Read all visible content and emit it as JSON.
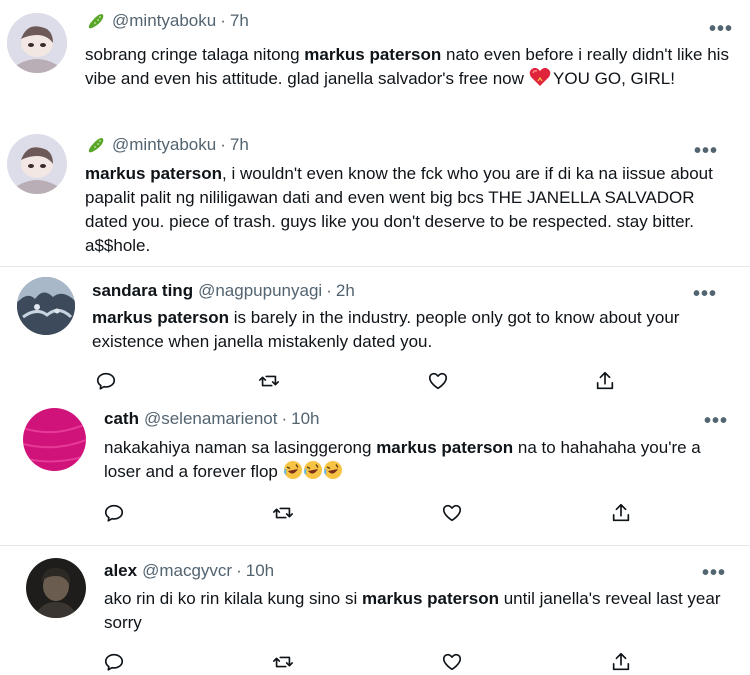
{
  "tweets": [
    {
      "name": "",
      "handle": "@mintyaboku",
      "sep": "·",
      "time": "7h",
      "more": "•••",
      "body": {
        "t1": "sobrang cringe talaga nitong ",
        "b1": "markus paterson",
        "t2": " nato even before i really didn't like his vibe and even his attitude. glad janella salvador's free now ",
        "t3": " YOU GO, GIRL!"
      }
    },
    {
      "name": "",
      "handle": "@mintyaboku",
      "sep": "·",
      "time": "7h",
      "more": "•••",
      "body": {
        "b1": "markus paterson",
        "t1": ", i wouldn't even know the fck who you are if di ka na iissue about papalit palit ng nililigawan dati and even went big bcs THE JANELLA SALVADOR dated you. piece of trash. guys like you don't deserve to be respected. stay bitter. a$$hole."
      }
    },
    {
      "name": "sandara ting",
      "handle": "@nagpupunyagi",
      "sep": "·",
      "time": "2h",
      "more": "•••",
      "body": {
        "b1": "markus paterson",
        "t1": " is barely in the industry. people only got to know about your existence when janella mistakenly dated you."
      }
    },
    {
      "name": "cath",
      "handle": "@selenamarienot",
      "sep": "·",
      "time": "10h",
      "more": "•••",
      "body": {
        "t1": "nakakahiya naman sa lasinggerong ",
        "b1": "markus paterson",
        "t2": " na to hahahaha you're a loser and a forever flop "
      }
    },
    {
      "name": "alex",
      "handle": "@macgyvcr",
      "sep": "·",
      "time": "10h",
      "more": "•••",
      "body": {
        "t1": "ako rin di ko rin kilala kung sino si ",
        "b1": "markus paterson",
        "t2": " until janella's reveal last year sorry"
      }
    }
  ],
  "icons": {
    "reply": "reply-icon",
    "retweet": "retweet-icon",
    "like": "heart-icon",
    "share": "share-icon",
    "pickle": "cucumber-emoji",
    "heart_emoji": "heart-fire-emoji",
    "rofl": "rofl-emoji"
  },
  "colors": {
    "text": "#0f1419",
    "muted": "#536471",
    "divider": "#e6e9ec",
    "cath_avatar": "#d0137a"
  }
}
